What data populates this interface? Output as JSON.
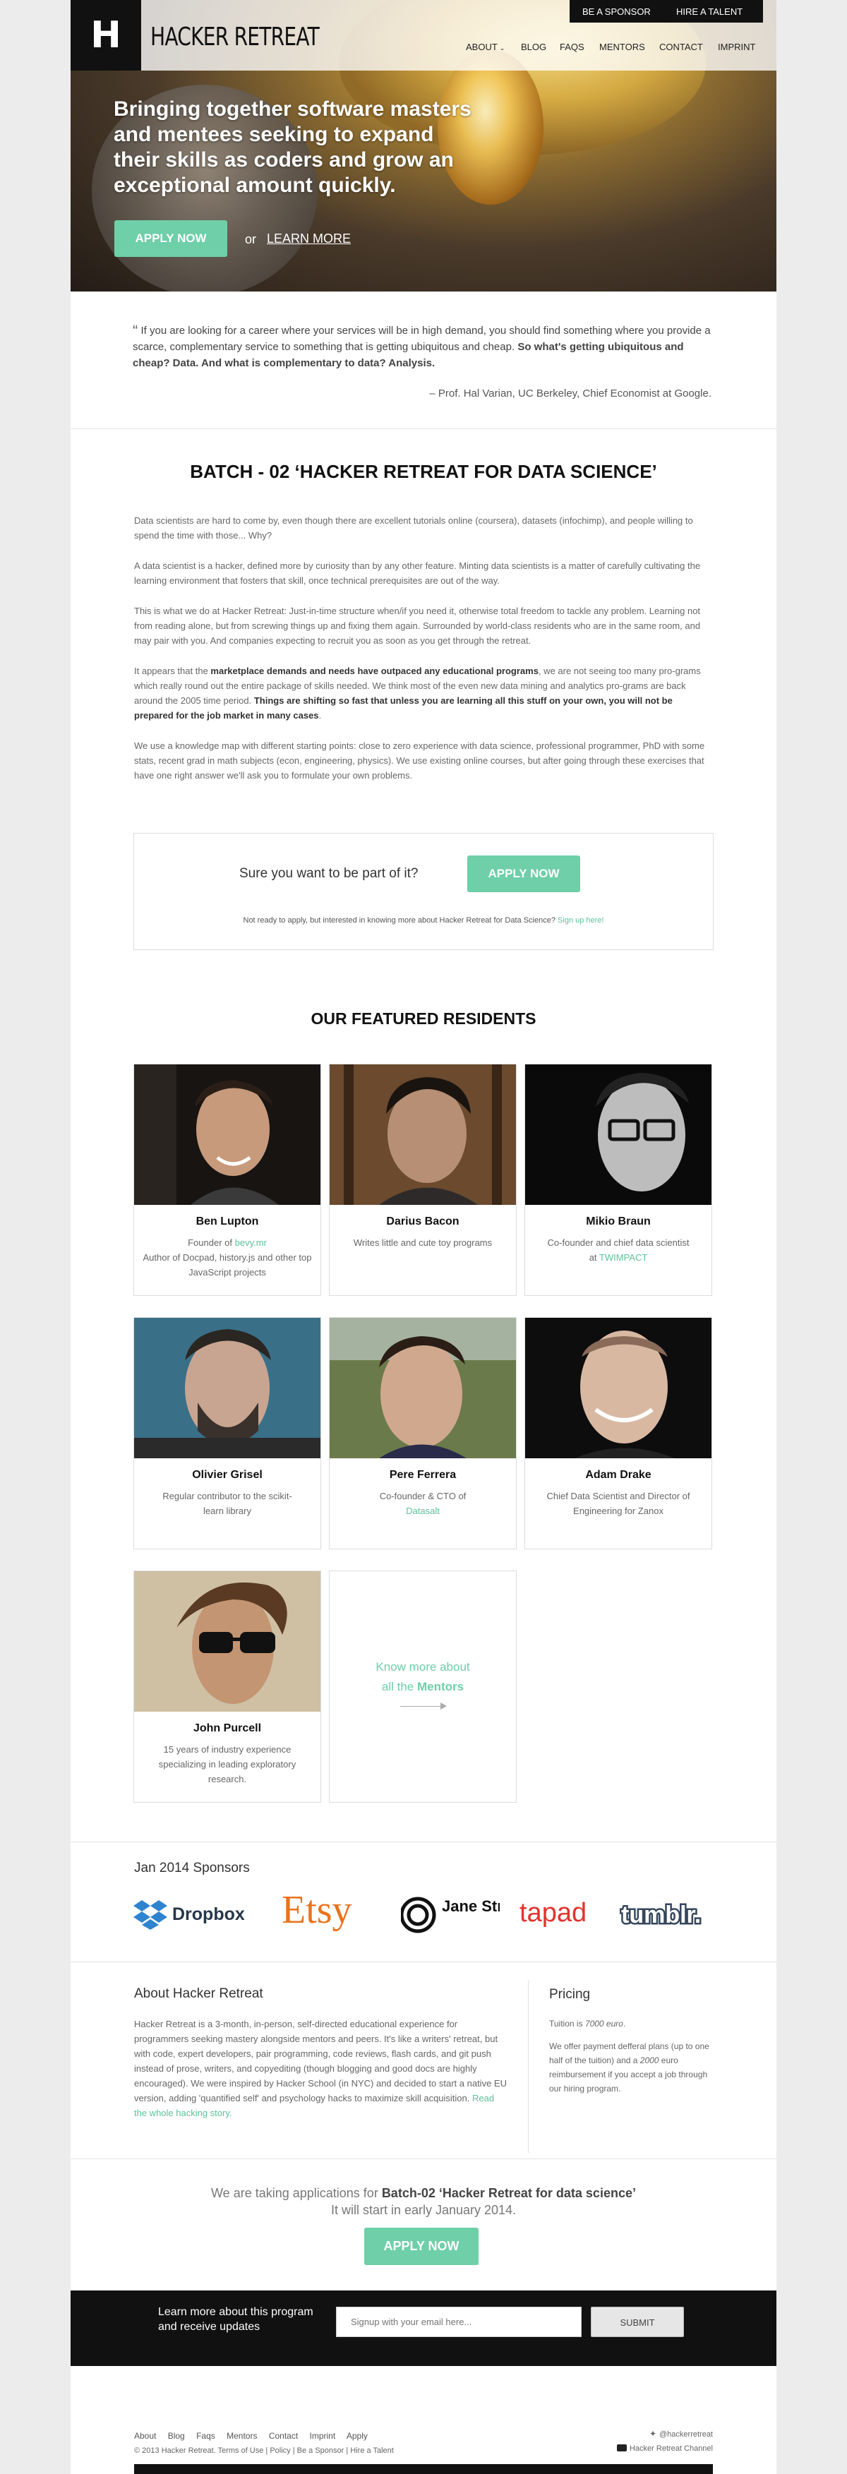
{
  "header": {
    "logo_letter": "H",
    "logo_text": "HACKER RETREAT",
    "top_links": [
      "BE A SPONSOR",
      "HIRE A TALENT"
    ],
    "nav": [
      "ABOUT",
      "BLOG",
      "FAQS",
      "MENTORS",
      "CONTACT",
      "IMPRINT"
    ]
  },
  "hero": {
    "title": "Bringing together software masters and mentees seeking to expand their skills as coders and grow an exceptional amount quickly.",
    "apply_label": "APPLY NOW",
    "or_text": "or",
    "learn_label": "LEARN MORE"
  },
  "quote": {
    "mark": "“",
    "text": "If you are looking for a career where your services will be in high demand, you should find something where you provide a scarce, complementary service to something that is getting ubiquitous and cheap.",
    "bold": "So what's getting ubiquitous and cheap? Data. And what is complementary to data? Analysis.",
    "author": "– Prof. Hal Varian, UC Berkeley, Chief Economist at Google."
  },
  "batch": {
    "title": "BATCH - 02 ‘HACKER RETREAT FOR DATA SCIENCE’",
    "p1": "Data scientists are hard to come by, even though there are excellent tutorials online (coursera), datasets (infochimp), and people willing to spend the time with those... Why?",
    "p2": "A data scientist is a hacker, defined more by curiosity than by any other feature. Minting data scientists is a matter of carefully cultivating the learning environment that fosters that skill, once technical prerequisites are out of the way.",
    "p3": "This is what we do at Hacker Retreat: Just-in-time structure when/if you need it, otherwise total freedom to tackle any problem. Learning not from reading alone, but from screwing things up and fixing them again. Surrounded by world-class residents who are in the same room, and may pair with you. And companies expecting to recruit you as soon as you get through the retreat.",
    "p4_a": "It appears that the ",
    "p4_b": "marketplace demands and needs have outpaced any educational programs",
    "p4_c": ", we are not seeing too many pro-grams which really round out the entire package of skills needed. We think most of the even new data mining and analytics pro-grams are back around the 2005 time period. ",
    "p4_d": "Things are shifting so fast that unless you are learning all this stuff on your own, you will not be prepared for the job market in many cases",
    "p4_e": ".",
    "p5": "We use a knowledge map with different starting points: close to zero experience with data science, professional programmer, PhD with some stats, recent grad in math subjects (econ, engineering, physics). We use existing online courses, but after going through these exercises that have one right answer we'll ask you to formulate your own problems."
  },
  "cta": {
    "question": "Sure you want to be part of it?",
    "apply_label": "APPLY NOW",
    "note": "Not ready to apply, but interested in knowing more about Hacker Retreat for Data Science?",
    "signup": "Sign up here!"
  },
  "residents": {
    "title": "OUR FEATURED RESIDENTS",
    "people": [
      {
        "name": "Ben Lupton",
        "bio_a": "Founder of ",
        "link": "bevy.mr",
        "bio_b": "\nAuthor of Docpad, history.js and other top JavaScript projects"
      },
      {
        "name": "Darius Bacon",
        "bio_a": "Writes little and cute toy programs",
        "link": "",
        "bio_b": ""
      },
      {
        "name": "Mikio Braun",
        "bio_a": "Co-founder and chief data scientist at ",
        "link": "TWIMPACT",
        "bio_b": ""
      },
      {
        "name": "Olivier Grisel",
        "bio_a": "Regular contributor to the scikit-learn library",
        "link": "",
        "bio_b": ""
      },
      {
        "name": "Pere Ferrera",
        "bio_a": "Co-founder & CTO of ",
        "link": "Datasalt",
        "bio_b": ""
      },
      {
        "name": "Adam Drake",
        "bio_a": "Chief Data Scientist and Director of Engineering for Zanox",
        "link": "",
        "bio_b": ""
      },
      {
        "name": "John Purcell",
        "bio_a": "15 years of industry experience specializing in leading exploratory research.",
        "link": "",
        "bio_b": ""
      }
    ],
    "mentors_a": "Know more about",
    "mentors_b": "all the ",
    "mentors_link": "Mentors"
  },
  "sponsors": {
    "title": "Jan 2014 Sponsors",
    "names": [
      "Dropbox",
      "Etsy",
      "Jane Street",
      "tapad",
      "tumblr."
    ]
  },
  "about": {
    "title": "About Hacker Retreat",
    "body": "Hacker Retreat is a 3-month, in-person, self-directed educational experience for programmers seeking mastery alongside mentors and peers. It's like a writers' retreat, but with code, expert developers, pair programming, code reviews, flash cards, and git push instead of prose, writers, and copyediting (though blogging and good docs are highly encouraged). We were inspired by Hacker School (in NYC) and decided to start a native EU version, adding 'quantified self' and psychology hacks to maximize skill acquisition.",
    "read_link": "Read the whole hacking story."
  },
  "pricing": {
    "title": "Pricing",
    "tuition_label": "Tuition is ",
    "tuition_value": "7000 euro",
    "tuition_end": ".",
    "body_a": "We offer payment defferal plans (up to one half of the tuition) and a ",
    "body_b": "2000",
    "body_c": " euro reimbursement if you accept a job through our hiring program."
  },
  "applications": {
    "line1_a": "We are taking applications for ",
    "line1_b": "Batch-02 ‘Hacker Retreat for data science’",
    "line2": "It will start in early January 2014.",
    "apply_label": "APPLY NOW"
  },
  "newsletter": {
    "text": "Learn more about this program and receive updates",
    "placeholder": "Signup with your email here...",
    "submit": "SUBMIT"
  },
  "footer": {
    "links": [
      "About",
      "Blog",
      "Faqs",
      "Mentors",
      "Contact",
      "Imprint",
      "Apply"
    ],
    "copy": "© 2013 Hacker Retreat. Terms of Use | Policy  |  Be a Sponsor  |  Hire a Talent",
    "twitter": "@hackerretreat",
    "youtube": "Hacker Retreat Channel"
  },
  "colors": {
    "accent": "#6ecfa8",
    "link": "#5cc29a",
    "dark": "#111111"
  }
}
